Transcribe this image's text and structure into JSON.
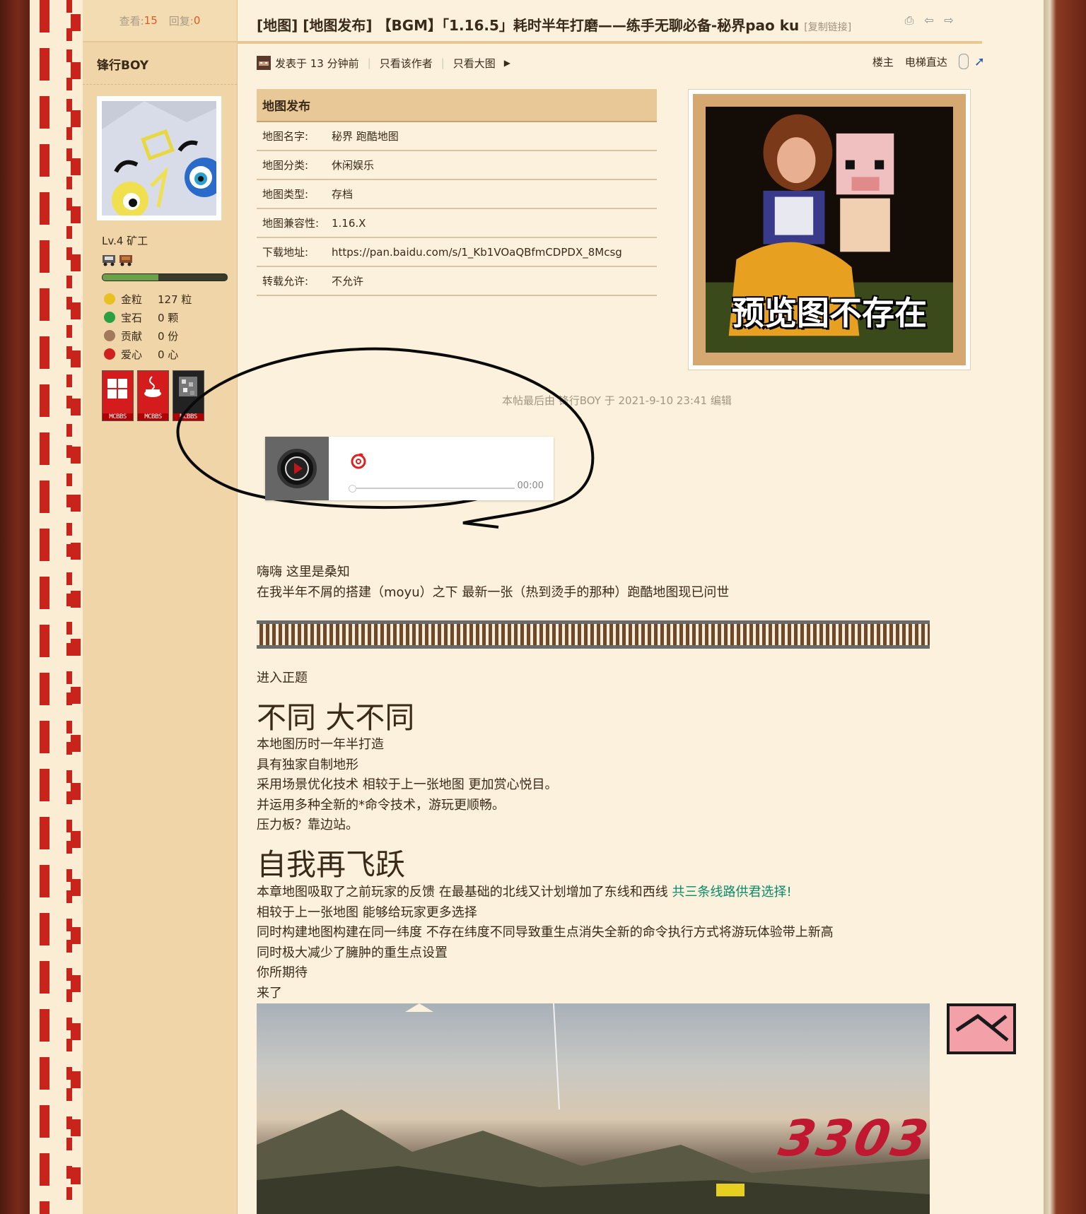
{
  "stats": {
    "views_label": "查看:",
    "views": "15",
    "replies_label": "回复:",
    "replies": "0"
  },
  "user": {
    "name": "锋行BOY",
    "level": "Lv.4 矿工",
    "level_progress_fraction": 0.45,
    "credits": [
      {
        "icon": "gold-nugget-icon",
        "color": "#e8c020",
        "label": "金粒",
        "value": "127 粒"
      },
      {
        "icon": "emerald-icon",
        "color": "#2aa040",
        "label": "宝石",
        "value": "0 颗"
      },
      {
        "icon": "cookie-icon",
        "color": "#a07a5a",
        "label": "贡献",
        "value": "0 份"
      },
      {
        "icon": "apple-icon",
        "color": "#d02020",
        "label": "爱心",
        "value": "0 心"
      }
    ],
    "badges": [
      "MCBBS",
      "MCBBS",
      "MCBBS"
    ]
  },
  "post": {
    "title": "[地图] [地图发布] 【BGM】「1.16.5」耗时半年打磨——练手无聊必备-秘界pao ku",
    "copy_link": "[复制链接]",
    "meta": {
      "posted": "发表于 13 分钟前",
      "only_author": "只看该作者",
      "only_big_images": "只看大图",
      "floor": "楼主",
      "elevator": "电梯直达"
    },
    "info_table": {
      "header": "地图发布",
      "rows": [
        {
          "k": "地图名字:",
          "v": "秘界 跑酷地图"
        },
        {
          "k": "地图分类:",
          "v": "休闲娱乐"
        },
        {
          "k": "地图类型:",
          "v": "存档"
        },
        {
          "k": "地图兼容性:",
          "v": "1.16.X"
        },
        {
          "k": "下载地址:",
          "v": "https://pan.baidu.com/s/1_Kb1VOaQBfmCDPDX_8Mcsg"
        },
        {
          "k": "转载允许:",
          "v": "不允许"
        }
      ]
    },
    "preview_text": "预览图不存在",
    "edit_note": "本帖最后由 锋行BOY 于 2021-9-10 23:41 编辑",
    "player_time": "00:00",
    "intro": [
      "嗨嗨 这里是桑知",
      "在我半年不屑的搭建（moyu）之下 最新一张（热到烫手的那种）跑酷地图现已问世"
    ],
    "section1_pre": "进入正题",
    "heading1": "不同 大不同",
    "section1": [
      "本地图历时一年半打造",
      "具有独家自制地形",
      "采用场景优化技术 相较于上一张地图 更加赏心悦目。",
      "并运用多种全新的*命令技术，游玩更顺畅。",
      "压力板？靠边站。"
    ],
    "heading2": "自我再飞跃",
    "section2_first": "本章地图吸取了之前玩家的反馈 在最基础的北线又计划增加了东线和西线 ",
    "section2_link": "共三条线路供君选择!",
    "section2": [
      "相较于上一张地图 能够给玩家更多选择",
      "同时构建地图构建在同一纬度 不存在纬度不同导致重生点消失全新的命令执行方式将游玩体验带上新高",
      "同时极大减少了臃肿的重生点设置",
      "你所期待",
      "来了"
    ],
    "screenshot_numbers": "3303"
  }
}
